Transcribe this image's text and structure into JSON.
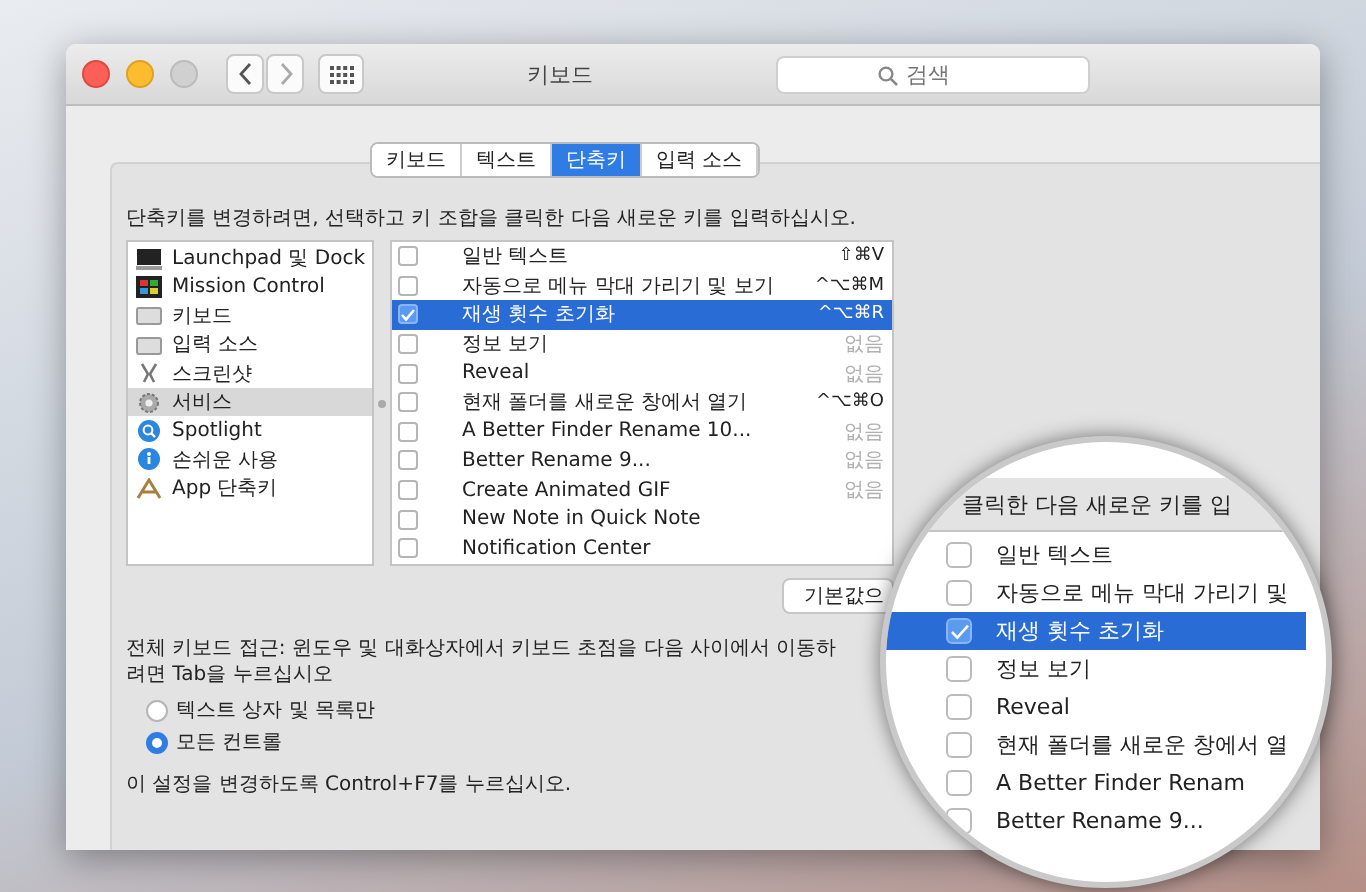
{
  "window": {
    "title": "키보드",
    "search_placeholder": "검색"
  },
  "tabs": [
    {
      "label": "키보드",
      "selected": false
    },
    {
      "label": "텍스트",
      "selected": false
    },
    {
      "label": "단축키",
      "selected": true
    },
    {
      "label": "입력 소스",
      "selected": false
    }
  ],
  "instruction": "단축키를 변경하려면, 선택하고 키 조합을 클릭한 다음 새로운 키를 입력하십시오.",
  "categories": [
    {
      "label": "Launchpad 및 Dock",
      "selected": false
    },
    {
      "label": "Mission Control",
      "selected": false
    },
    {
      "label": "키보드",
      "selected": false
    },
    {
      "label": "입력 소스",
      "selected": false
    },
    {
      "label": "스크린샷",
      "selected": false
    },
    {
      "label": "서비스",
      "selected": true
    },
    {
      "label": "Spotlight",
      "selected": false
    },
    {
      "label": "손쉬운 사용",
      "selected": false
    },
    {
      "label": "App 단축키",
      "selected": false
    }
  ],
  "shortcuts": [
    {
      "checked": false,
      "selected": false,
      "name": "일반 텍스트",
      "keys": "⇧⌘V",
      "dimmed": false
    },
    {
      "checked": false,
      "selected": false,
      "name": "자동으로 메뉴 막대 가리기 및 보기",
      "keys": "^⌥⌘M",
      "dimmed": false
    },
    {
      "checked": true,
      "selected": true,
      "name": "재생 횟수 초기화",
      "keys": "^⌥⌘R",
      "dimmed": false
    },
    {
      "checked": false,
      "selected": false,
      "name": "정보 보기",
      "keys": "없음",
      "dimmed": true
    },
    {
      "checked": false,
      "selected": false,
      "name": "Reveal",
      "keys": "없음",
      "dimmed": true
    },
    {
      "checked": false,
      "selected": false,
      "name": "현재 폴더를 새로운 창에서 열기",
      "keys": "^⌥⌘O",
      "dimmed": false
    },
    {
      "checked": false,
      "selected": false,
      "name": "A Better Finder Rename 10...",
      "keys": "없음",
      "dimmed": true
    },
    {
      "checked": false,
      "selected": false,
      "name": "Better Rename 9...",
      "keys": "없음",
      "dimmed": true
    },
    {
      "checked": false,
      "selected": false,
      "name": "Create Animated GIF",
      "keys": "없음",
      "dimmed": true
    },
    {
      "checked": false,
      "selected": false,
      "name": "New Note in Quick Note"
    },
    {
      "checked": false,
      "selected": false,
      "name": "Notification Center"
    }
  ],
  "restore_button": "기본값으",
  "keyboard_access": {
    "text": "전체 키보드 접근: 윈도우 및 대화상자에서 키보드 초점을 다음 사이에서 이동하려면 Tab을 누르십시오",
    "options": [
      {
        "label": "텍스트 상자 및 목록만",
        "selected": false
      },
      {
        "label": "모든 컨트롤",
        "selected": true
      }
    ],
    "note": "이 설정을 변경하도록 Control+F7를 누르십시오."
  },
  "magnifier": {
    "header": "클릭한 다음 새로운 키를 입",
    "rows": [
      {
        "checked": false,
        "selected": false,
        "name": "일반 텍스트"
      },
      {
        "checked": false,
        "selected": false,
        "name": "자동으로 메뉴 막대 가리기 및"
      },
      {
        "checked": true,
        "selected": true,
        "name": "재생 횟수 초기화"
      },
      {
        "checked": false,
        "selected": false,
        "name": "정보 보기"
      },
      {
        "checked": false,
        "selected": false,
        "name": "Reveal"
      },
      {
        "checked": false,
        "selected": false,
        "name": "현재 폴더를 새로운 창에서 열"
      },
      {
        "checked": false,
        "selected": false,
        "name": "A Better Finder Renam"
      },
      {
        "checked": false,
        "selected": false,
        "name": "Better Rename 9..."
      }
    ]
  }
}
